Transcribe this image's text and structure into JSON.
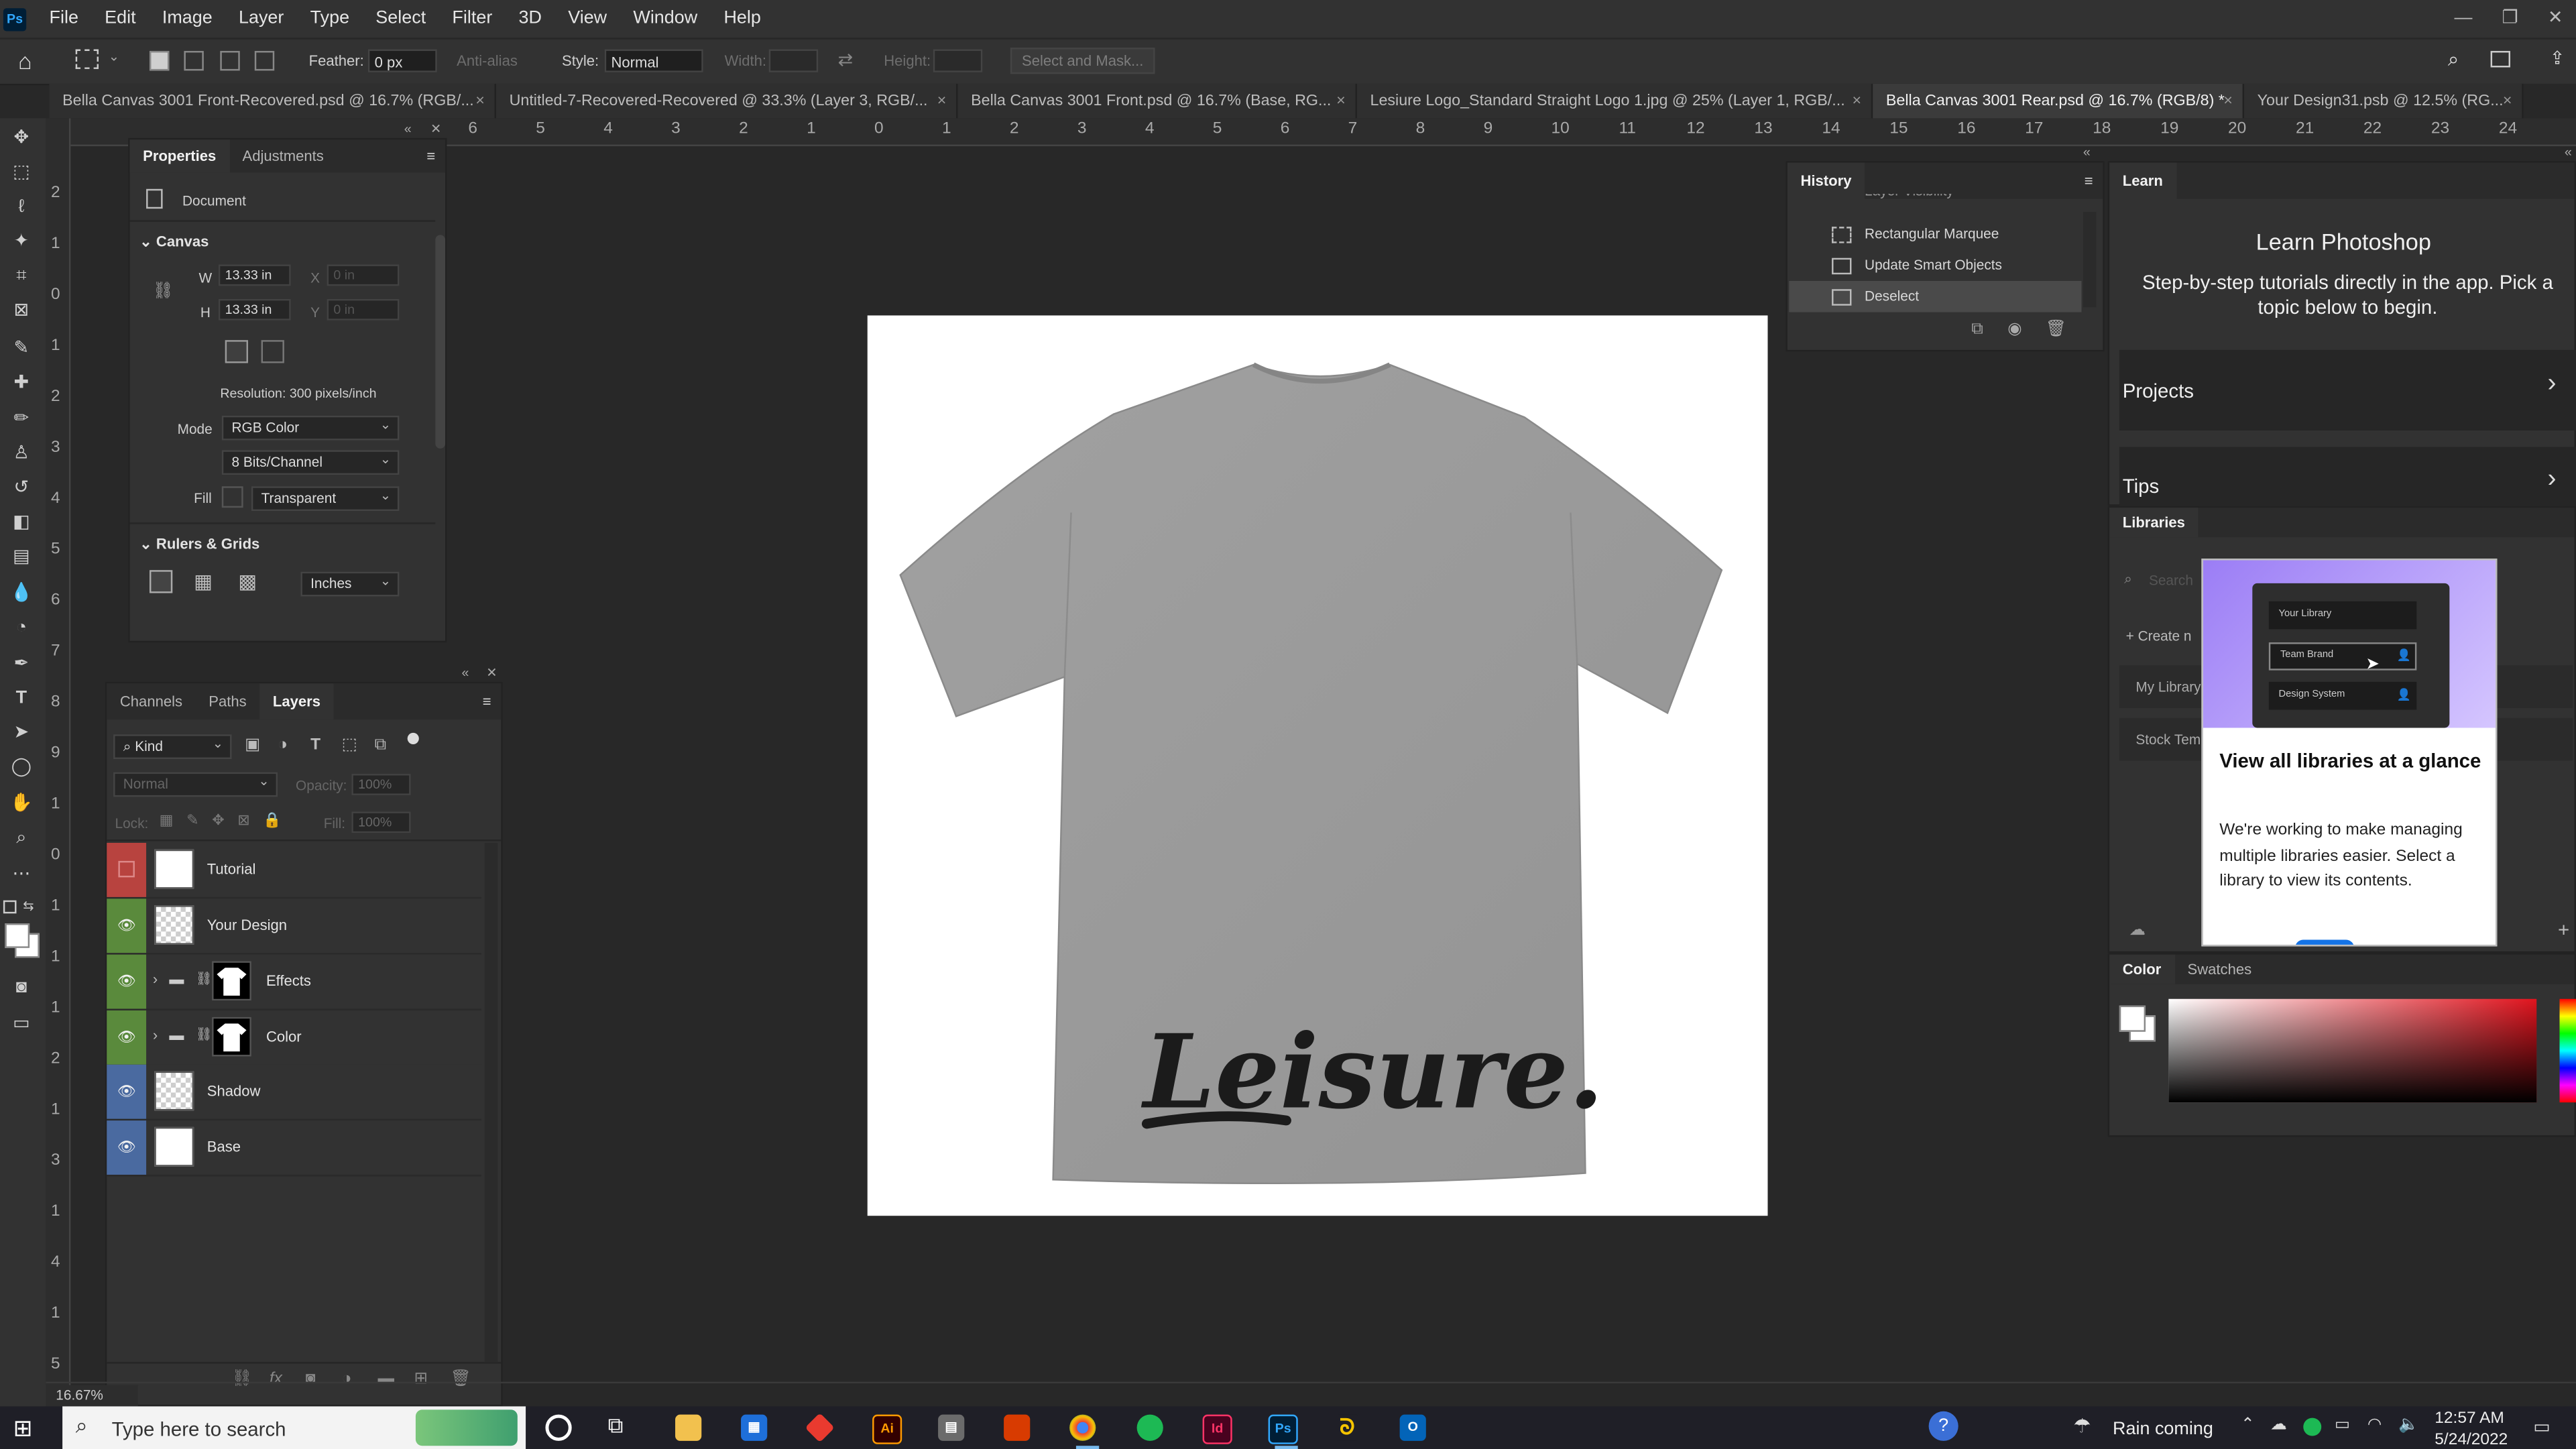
{
  "app": {
    "logo": "Ps"
  },
  "menu": [
    "File",
    "Edit",
    "Image",
    "Layer",
    "Type",
    "Select",
    "Filter",
    "3D",
    "View",
    "Window",
    "Help"
  ],
  "window_controls": {
    "minimize": "—",
    "restore": "❐",
    "close": "✕"
  },
  "options_bar": {
    "feather_label": "Feather:",
    "feather_value": "0 px",
    "antialias_label": "Anti-alias",
    "style_label": "Style:",
    "style_value": "Normal",
    "width_label": "Width:",
    "height_label": "Height:",
    "select_mask_label": "Select and Mask..."
  },
  "tabs": [
    {
      "label": "Bella Canvas 3001 Front-Recovered.psd @ 16.7% (RGB/...",
      "close": "×"
    },
    {
      "label": "Untitled-7-Recovered-Recovered @ 33.3% (Layer 3, RGB/...",
      "close": "×"
    },
    {
      "label": "Bella Canvas 3001 Front.psd @ 16.7% (Base, RG...",
      "close": "×"
    },
    {
      "label": "Lesiure Logo_Standard Straight Logo 1.jpg @ 25% (Layer 1, RGB/...",
      "close": "×"
    },
    {
      "label": "Bella Canvas 3001 Rear.psd @ 16.7% (RGB/8) *",
      "close": "×"
    },
    {
      "label": "Your Design31.psb @ 12.5% (RG...",
      "close": "×"
    }
  ],
  "ruler_top": [
    "6",
    "5",
    "4",
    "3",
    "2",
    "1",
    "0",
    "1",
    "2",
    "3",
    "4",
    "5",
    "6",
    "7",
    "8",
    "9",
    "10",
    "11",
    "12",
    "13",
    "14",
    "15",
    "16",
    "17",
    "18",
    "19",
    "20",
    "21",
    "22",
    "23",
    "24"
  ],
  "ruler_left": [
    "2",
    "1",
    "0",
    "1",
    "2",
    "3",
    "4",
    "5",
    "6",
    "7",
    "8",
    "9",
    "1",
    "0",
    "1",
    "1",
    "1",
    "2",
    "1",
    "3",
    "1",
    "4",
    "1",
    "5"
  ],
  "properties": {
    "tabs": [
      "Properties",
      "Adjustments"
    ],
    "doc_label": "Document",
    "canvas_header": "Canvas",
    "w_label": "W",
    "w_value": "13.33 in",
    "h_label": "H",
    "h_value": "13.33 in",
    "x_label": "X",
    "x_value": "0 in",
    "y_label": "Y",
    "y_value": "0 in",
    "resolution": "Resolution: 300 pixels/inch",
    "mode_label": "Mode",
    "mode_value": "RGB Color",
    "bits_value": "8 Bits/Channel",
    "fill_label": "Fill",
    "fill_value": "Transparent",
    "rulers_header": "Rulers & Grids",
    "units_value": "Inches"
  },
  "layers_panel": {
    "tabs": [
      "Channels",
      "Paths",
      "Layers"
    ],
    "filter_kind": "Kind",
    "blend_mode": "Normal",
    "opacity_label": "Opacity:",
    "opacity_value": "100%",
    "lock_label": "Lock:",
    "fill_label": "Fill:",
    "fill_value": "100%",
    "layers": [
      {
        "name": "Tutorial",
        "color": "#b8433f",
        "visible": false
      },
      {
        "name": "Your Design",
        "color": "#5a8a3c",
        "visible": true
      },
      {
        "name": "Effects",
        "color": "#5a8a3c",
        "visible": true
      },
      {
        "name": "Color",
        "color": "#5a8a3c",
        "visible": true
      },
      {
        "name": "Shadow",
        "color": "#4a6aa0",
        "visible": true
      },
      {
        "name": "Base",
        "color": "#4a6aa0",
        "visible": true
      }
    ]
  },
  "history": {
    "title": "History",
    "items": [
      "Layer Visibility",
      "Rectangular Marquee",
      "Update Smart Objects",
      "Deselect"
    ]
  },
  "learn": {
    "tab": "Learn",
    "title": "Learn Photoshop",
    "subtitle": "Step-by-step tutorials directly in the app. Pick a topic below to begin.",
    "projects": "Projects",
    "tips": "Tips"
  },
  "libraries": {
    "tab": "Libraries",
    "search_placeholder": "Search",
    "create": "Create n",
    "my_library": "My Library",
    "stock_templates": "Stock Tem",
    "popup": {
      "lib1": "Your Library",
      "lib2": "Team Brand",
      "lib3": "Design System",
      "title": "View all libraries at a glance",
      "body": "We're working to make managing multiple libraries easier. Select a library to view its contents."
    }
  },
  "color_panel": {
    "tabs": [
      "Color",
      "Swatches"
    ]
  },
  "canvas": {
    "design_text": "Leisure."
  },
  "zoom": "16.67%",
  "taskbar": {
    "search_placeholder": "Type here to search",
    "weather": "Rain coming",
    "time": "12:57 AM",
    "date": "5/24/2022",
    "apps": [
      "Ai",
      "Id",
      "Ps"
    ]
  },
  "colors": {
    "accent": "#31a8ff",
    "tshirt": "#9a9a9a",
    "bg": "#282828",
    "panel": "#323232"
  }
}
